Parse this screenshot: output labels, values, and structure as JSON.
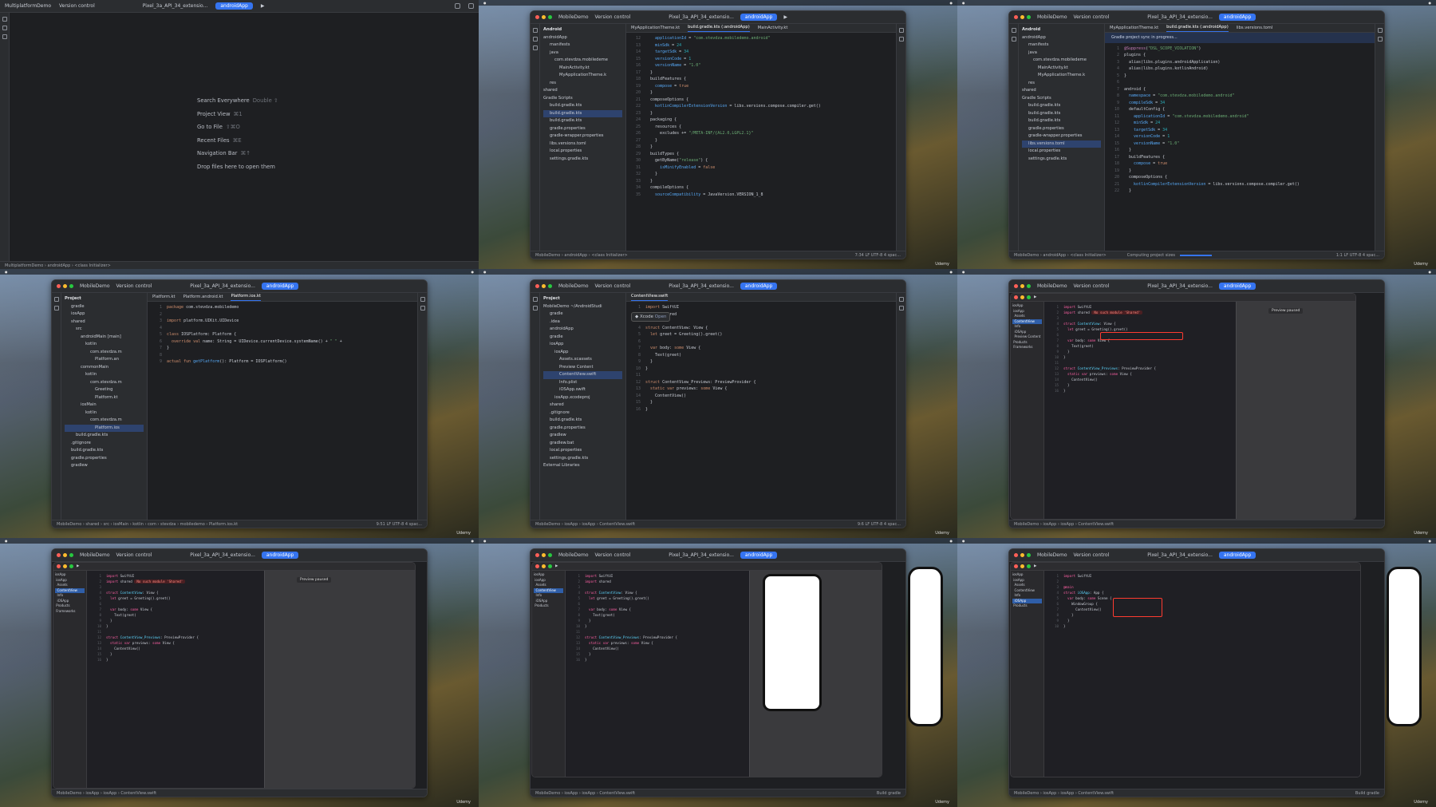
{
  "ide": {
    "project": "MobileDemo",
    "project_welcome": "MultiplatformDemo",
    "version_control": "Version control",
    "device": "Pixel_3a_API_34_extensio...",
    "run_config": "androidApp",
    "project_view": "Project",
    "android_view": "Android"
  },
  "welcome": {
    "items": [
      {
        "label": "Search Everywhere",
        "shortcut": "Double ⇧"
      },
      {
        "label": "Project View",
        "shortcut": "⌘1"
      },
      {
        "label": "Go to File",
        "shortcut": "⇧⌘O"
      },
      {
        "label": "Recent Files",
        "shortcut": "⌘E"
      },
      {
        "label": "Navigation Bar",
        "shortcut": "⌘↑"
      },
      {
        "label": "Drop files here to open them",
        "shortcut": ""
      }
    ],
    "status": "MultiplatformDemo › androidApp › <class Initializer>"
  },
  "f2": {
    "tabs": [
      "MyApplicationTheme.kt",
      "build.gradle.kts (:androidApp)",
      "MainActivity.kt"
    ],
    "tree": [
      "androidApp",
      "manifests",
      "java",
      "com.stevdza.mobiledeme",
      "MainActivity.kt",
      "MyApplicationTheme.k",
      "res",
      "shared",
      "Gradle Scripts",
      "build.gradle.kts",
      "build.gradle.kts",
      "build.gradle.kts",
      "gradle.properties",
      "gradle-wrapper.properties",
      "libs.versions.toml",
      "local.properties",
      "settings.gradle.kts"
    ],
    "status_left": "MobileDemo › androidApp › <class Initializer>",
    "status_right": "7:34  LF  UTF-8  4 spac..."
  },
  "f3": {
    "tabs": [
      "MyApplicationTheme.kt",
      "build.gradle.kts (:androidApp)",
      "libs.versions.toml"
    ],
    "banner": "Gradle project sync in progress...",
    "status_left": "MobileDemo › androidApp › <class Initializer>",
    "status_mid": "Computing project sizes",
    "status_right": "1:1  LF  UTF-8  4 spac..."
  },
  "f4": {
    "tabs": [
      "Platform.kt",
      "Platform.android.kt",
      "Platform.ios.kt"
    ],
    "tree": [
      "gradle",
      "iosApp",
      "shared",
      "src",
      "androidMain [main]",
      "kotlin",
      "com.stevdza.m",
      "Platform.an",
      "commonMain",
      "kotlin",
      "com.stevdza.m",
      "Greeting",
      "Platform.kt",
      "iosMain",
      "kotlin",
      "com.stevdza.m",
      "Platform.ios",
      "build.gradle.kts",
      ".gitignore",
      "build.gradle.kts",
      "gradle.properties",
      "gradlew"
    ],
    "status_left": "MobileDemo › shared › src › iosMain › kotlin › com › stevdza › mobiledemo › Platform.ios.kt",
    "status_right": "9:51  LF  UTF-8  4 spac..."
  },
  "f5": {
    "tabs": [
      "ContentView.swift"
    ],
    "tree": [
      "MobileDemo ~/AndroidStudi",
      "gradle",
      ".idea",
      "androidApp",
      "gradle",
      "iosApp",
      "iosApp",
      "Assets.xcassets",
      "Preview Content",
      "ContentView.swift",
      "Info.plist",
      "iOSApp.swift",
      "iosApp.xcodeproj",
      "shared",
      ".gitignore",
      "build.gradle.kts",
      "gradle.properties",
      "gradlew",
      "gradlew.bat",
      "local.properties",
      "settings.gradle.kts",
      "External Libraries"
    ],
    "popup_label": "Xcode",
    "popup_action": "Open",
    "status_left": "MobileDemo › iosApp › iosApp › ContentView.swift",
    "status_right": "9:6  LF  UTF-8  4 spac..."
  },
  "xcode": {
    "error": "No such module 'Shared'",
    "preview_paused": "Preview paused",
    "status": "MobileDemo › iosApp › iosApp › ContentView.swift",
    "status_right": "Build gradle"
  },
  "watermark": "Udemy"
}
